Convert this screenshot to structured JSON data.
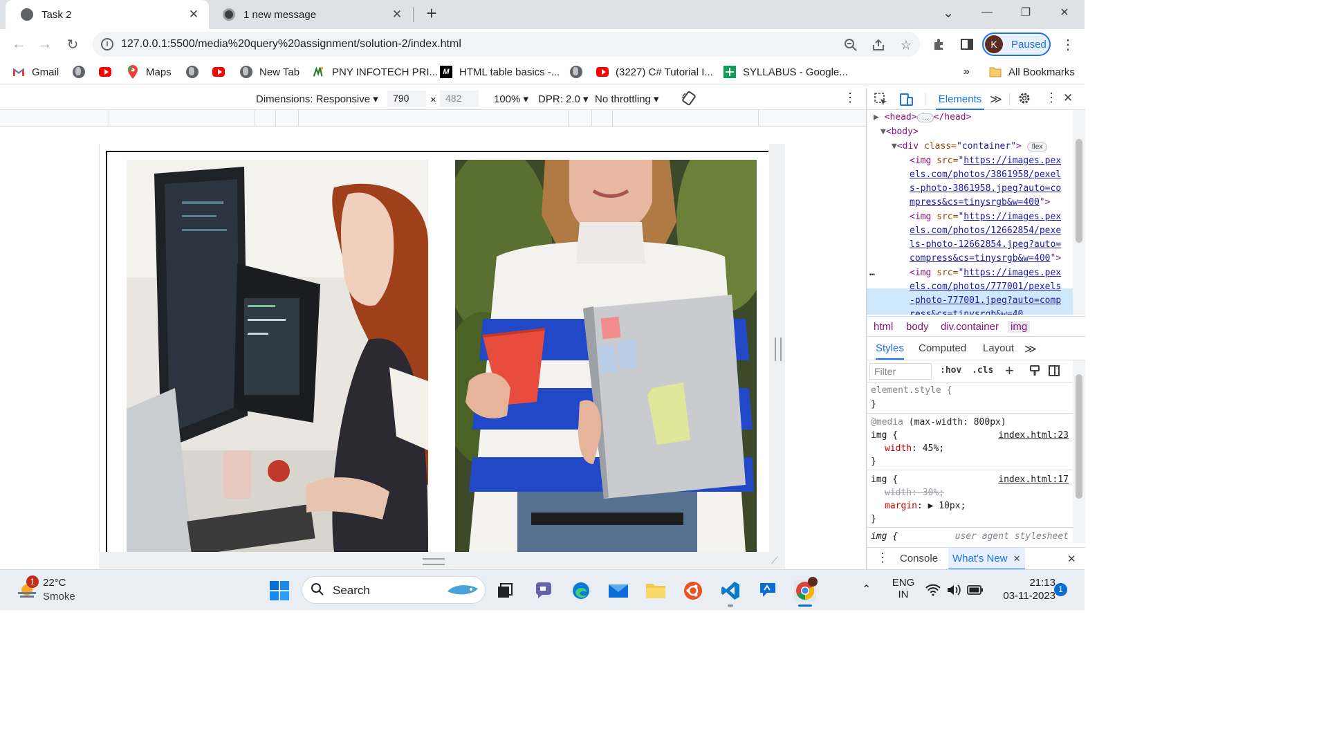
{
  "tabs": [
    {
      "title": "Task 2",
      "close": "✕"
    },
    {
      "title": "1 new message",
      "close": "✕"
    }
  ],
  "new_tab": "+",
  "window_controls": {
    "dropdown": "⌄",
    "minimize": "—",
    "restore": "❐",
    "close": "✕"
  },
  "omnibox": {
    "url": "127.0.0.1:5500/media%20query%20assignment/solution-2/index.html"
  },
  "profile": {
    "initial": "K",
    "status": "Paused"
  },
  "bookmarks": [
    {
      "label": "Gmail",
      "icon": "gmail-icon"
    },
    {
      "label": "",
      "icon": "globe-icon"
    },
    {
      "label": "",
      "icon": "youtube-icon"
    },
    {
      "label": "Maps",
      "icon": "maps-icon"
    },
    {
      "label": "",
      "icon": "globe-icon"
    },
    {
      "label": "",
      "icon": "youtube-icon"
    },
    {
      "label": "New Tab",
      "icon": "globe-icon"
    },
    {
      "label": "PNY INFOTECH PRI...",
      "icon": "pny-icon"
    },
    {
      "label": "HTML table basics -...",
      "icon": "mdn-icon"
    },
    {
      "label": "",
      "icon": "globe-icon"
    },
    {
      "label": "(3227) C# Tutorial I...",
      "icon": "youtube-icon"
    },
    {
      "label": "SYLLABUS - Google...",
      "icon": "sheets-icon"
    }
  ],
  "bookmarks_overflow": "»",
  "all_bookmarks": "All Bookmarks",
  "device_toolbar": {
    "dimensions": "Dimensions: Responsive",
    "width": "790",
    "times": "×",
    "height": "482",
    "zoom": "100%",
    "dpr": "DPR: 2.0",
    "throttling": "No throttling"
  },
  "devtools": {
    "tabs": {
      "elements": "Elements",
      "more": "≫"
    },
    "dom": {
      "head_open": "<head>",
      "head_ellipsis": "…",
      "head_close": "</head>",
      "body": "<body>",
      "div_open": "<div ",
      "div_attr": "class=",
      "div_val": "\"container\"",
      "div_end": ">",
      "flex_badge": "flex",
      "img1_lines": [
        "https://images.pex",
        "els.com/photos/3861958/pexel",
        "s-photo-3861958.jpeg?auto=co",
        "mpress&cs=tinysrgb&w=400"
      ],
      "img2_lines": [
        "https://images.pex",
        "els.com/photos/12662854/pexe",
        "ls-photo-12662854.jpeg?auto=",
        "compress&cs=tinysrgb&w=400"
      ],
      "img3_lines": [
        "https://images.pex",
        "els.com/photos/777001/pexels",
        "-photo-777001.jpeg?auto=comp",
        "ress&cs=tinysrgb&w=40"
      ],
      "img_tag": "<img ",
      "src_attr": "src=",
      "quote": "\"",
      "end_quote": "\">",
      "ellipsis": "…"
    },
    "crumbs": [
      "html",
      "body",
      "div.container",
      "img"
    ],
    "subtabs": {
      "styles": "Styles",
      "computed": "Computed",
      "layout": "Layout",
      "more": "≫"
    },
    "filter_placeholder": "Filter",
    "hov": ":hov",
    "cls": ".cls",
    "styles": {
      "element_style": "element.style {",
      "close_brace": "}",
      "media_prefix": "@media",
      "media_query": "(max-width: 800px)",
      "img_sel": "img {",
      "src1": "index.html:23",
      "width45_prop": "width",
      "width45_val": ": 45%;",
      "src2": "index.html:17",
      "width30": "width: 30%;",
      "margin_prop": "margin",
      "margin_val": ": ▶ 10px;",
      "ua_sel": "img {",
      "ua_src": "user agent stylesheet"
    },
    "drawer": {
      "console": "Console",
      "whats_new": "What's New",
      "close": "✕"
    }
  },
  "taskbar": {
    "weather": {
      "temp": "22°C",
      "condition": "Smoke",
      "badge": "1"
    },
    "search_label": "Search",
    "lang": "ENG",
    "lang_sub": "IN",
    "time": "21:13",
    "date": "03-11-2023",
    "notif_badge": "1"
  },
  "colors": {
    "accent": "#1a73e8",
    "chrome_tab_bg": "#dee1e6",
    "devtools_selected": "#cfe8fc"
  }
}
